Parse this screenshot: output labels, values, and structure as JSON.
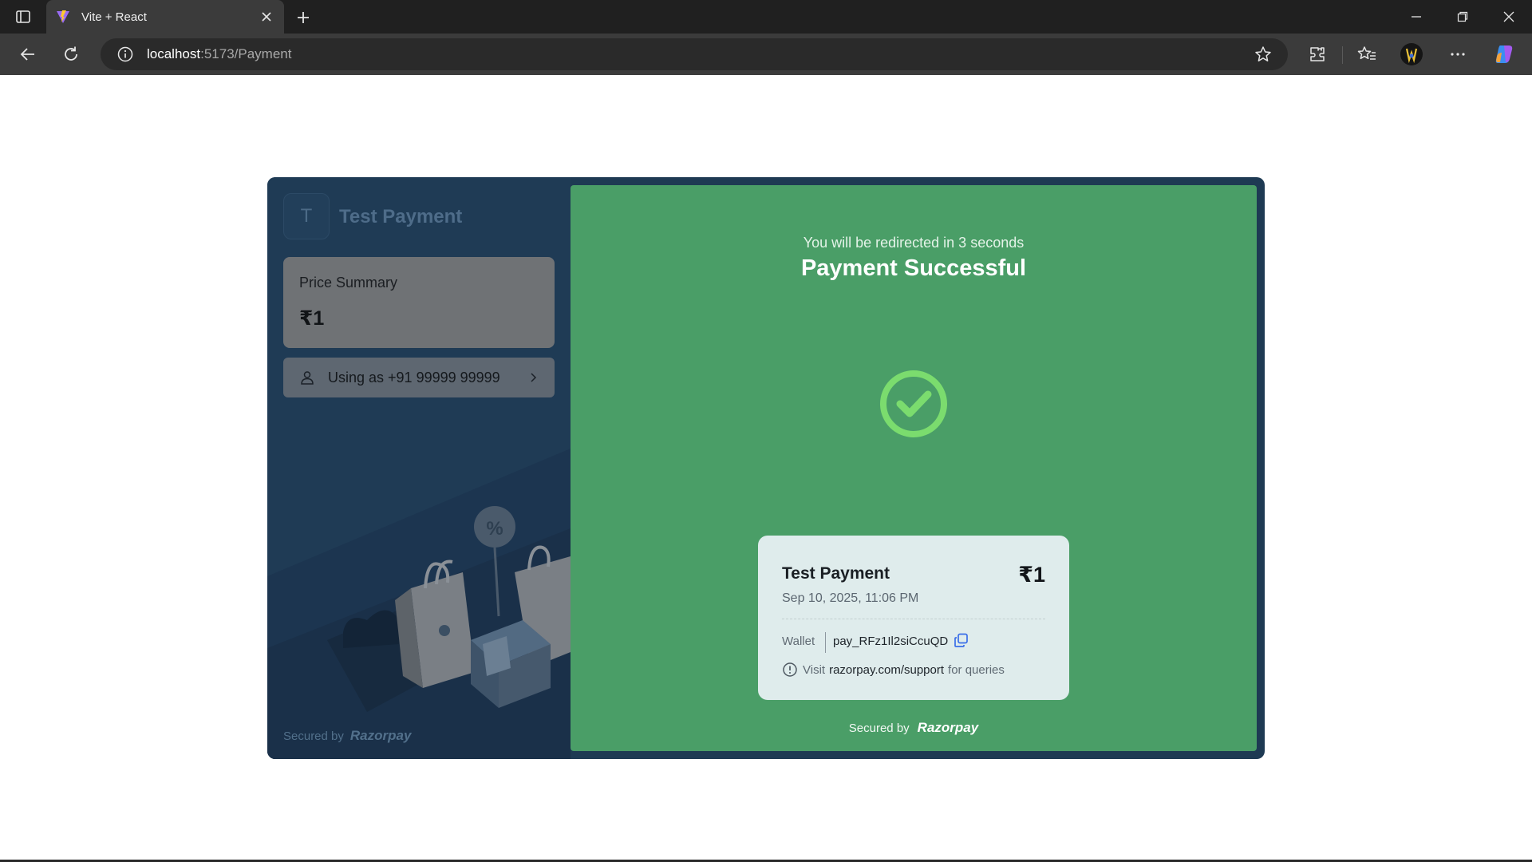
{
  "browser": {
    "tab_title": "Vite + React",
    "url_host": "localhost",
    "url_rest": ":5173/Payment"
  },
  "merchant": {
    "initial": "T",
    "name": "Test Payment"
  },
  "price_summary": {
    "label": "Price Summary",
    "amount": "₹1"
  },
  "contact": {
    "text": "Using as +91 99999 99999"
  },
  "left_footer": {
    "secured_label": "Secured by",
    "brand": "Razorpay"
  },
  "status": {
    "redirect_text": "You will be redirected in 3 seconds",
    "title": "Payment Successful"
  },
  "receipt": {
    "merchant": "Test Payment",
    "amount": "₹1",
    "date": "Sep 10, 2025, 11:06 PM",
    "method": "Wallet",
    "payment_id": "pay_RFz1Il2siCcuQD",
    "support_prefix": "Visit",
    "support_link": "razorpay.com/support",
    "support_suffix": "for queries"
  },
  "right_footer": {
    "secured_label": "Secured by",
    "brand": "Razorpay"
  },
  "colors": {
    "success_green": "#4a9e67",
    "panel_navy": "#1f3b55",
    "check_green": "#7bdc6e"
  }
}
